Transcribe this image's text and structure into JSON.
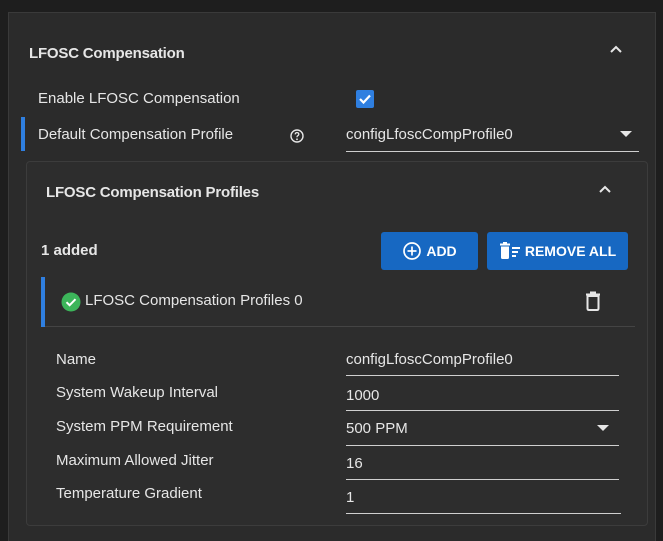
{
  "section": {
    "title": "LFOSC Compensation",
    "enable_label": "Enable LFOSC Compensation",
    "enable_checked": true,
    "default_profile_label": "Default Compensation Profile",
    "default_profile_value": "configLfoscCompProfile0"
  },
  "profiles": {
    "title": "LFOSC Compensation Profiles",
    "count_label": "1 added",
    "add_label": "ADD",
    "remove_all_label": "REMOVE ALL",
    "item": {
      "label": "LFOSC Compensation Profiles 0",
      "status": "ok"
    }
  },
  "form": {
    "name_label": "Name",
    "name_value": "configLfoscCompProfile0",
    "wakeup_label": "System Wakeup Interval",
    "wakeup_value": "1000",
    "ppm_label": "System PPM Requirement",
    "ppm_value": "500 PPM",
    "jitter_label": "Maximum Allowed Jitter",
    "jitter_value": "16",
    "gradient_label": "Temperature Gradient",
    "gradient_value": "1"
  },
  "colors": {
    "accent": "#2f7fe0",
    "button": "#1768c2",
    "success": "#3cb55a"
  }
}
